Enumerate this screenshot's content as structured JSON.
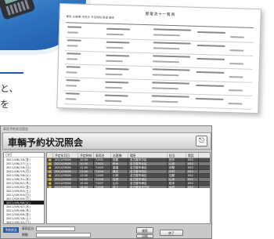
{
  "left_text": {
    "line1": "と、",
    "line2": "を"
  },
  "report": {
    "title": "屋電池十一覧表",
    "head": "車両 お客様 予約日 予定時刻 用途 備考"
  },
  "app": {
    "caption": "車両予約状況照会",
    "title": "車輌予約状況照会",
    "exit_icon": "exit-icon",
    "tree": {
      "header": "日付",
      "items": [
        "2011/08/26(金)",
        "2011/08/27(土)",
        "2011/08/28(日)",
        "2011/08/29(月)",
        "2011/08/30(火)",
        "2011/08/31(水)",
        "2011/09/01(木)",
        "2011/09/02(金)",
        "2011/09/03(土)",
        "2011/09/04(日)",
        "2011/09/05(月)",
        "2011/09/06(火)",
        "2011/09/07(水)",
        "2011/09/08(木)",
        "2011/09/09(金)",
        "2011/09/10(土)",
        "2011/09/11(日)",
        "2011/09/12(月)",
        "2011/09/13(火)"
      ],
      "selected_index": 11
    },
    "grid": {
      "columns": [
        "",
        "予定年月日",
        "予定時刻",
        "車両名",
        "お客様",
        "場所",
        "担当",
        "電話"
      ],
      "rows": [
        [
          "■",
          "2011/09/06",
          "10:00",
          "T-001",
          "佐藤",
          "名古屋市中区",
          "田中",
          "052"
        ],
        [
          "■",
          "2011/09/06",
          "10:30",
          "T-002",
          "鈴木",
          "名古屋市北区",
          "山田",
          "052"
        ],
        [
          "■",
          "2011/09/06",
          "11:00",
          "T-003",
          "高橋",
          "名古屋市東区",
          "伊藤",
          "052"
        ],
        [
          "■",
          "2011/09/06",
          "13:00",
          "T-004",
          "渡辺",
          "名古屋市西区",
          "中村",
          "052"
        ],
        [
          "■",
          "2011/09/06",
          "13:30",
          "T-005",
          "小林",
          "名古屋市南区",
          "加藤",
          "052"
        ],
        [
          "■",
          "2011/09/06",
          "14:00",
          "T-006",
          "吉田",
          "名古屋市港区",
          "山本",
          "052"
        ],
        [
          "■",
          "2011/09/06",
          "15:00",
          "T-007",
          "山口",
          "名古屋市緑区",
          "松本",
          "052"
        ],
        [
          "■",
          "2011/09/06",
          "16:00",
          "T-008",
          "井上",
          "名古屋市天白区",
          "木村",
          "052"
        ]
      ]
    },
    "bottom": {
      "status_tag": "予約状況",
      "vehicle_label": "車両区分",
      "period_label": "期間",
      "search_button": "検索",
      "print_button": "印刷",
      "close_button": "終了"
    }
  }
}
